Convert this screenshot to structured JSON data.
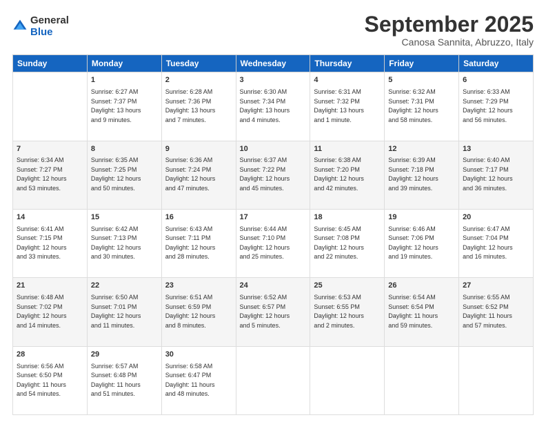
{
  "logo": {
    "general": "General",
    "blue": "Blue"
  },
  "title": "September 2025",
  "location": "Canosa Sannita, Abruzzo, Italy",
  "days_header": [
    "Sunday",
    "Monday",
    "Tuesday",
    "Wednesday",
    "Thursday",
    "Friday",
    "Saturday"
  ],
  "weeks": [
    [
      {
        "day": "",
        "content": ""
      },
      {
        "day": "1",
        "content": "Sunrise: 6:27 AM\nSunset: 7:37 PM\nDaylight: 13 hours\nand 9 minutes."
      },
      {
        "day": "2",
        "content": "Sunrise: 6:28 AM\nSunset: 7:36 PM\nDaylight: 13 hours\nand 7 minutes."
      },
      {
        "day": "3",
        "content": "Sunrise: 6:30 AM\nSunset: 7:34 PM\nDaylight: 13 hours\nand 4 minutes."
      },
      {
        "day": "4",
        "content": "Sunrise: 6:31 AM\nSunset: 7:32 PM\nDaylight: 13 hours\nand 1 minute."
      },
      {
        "day": "5",
        "content": "Sunrise: 6:32 AM\nSunset: 7:31 PM\nDaylight: 12 hours\nand 58 minutes."
      },
      {
        "day": "6",
        "content": "Sunrise: 6:33 AM\nSunset: 7:29 PM\nDaylight: 12 hours\nand 56 minutes."
      }
    ],
    [
      {
        "day": "7",
        "content": "Sunrise: 6:34 AM\nSunset: 7:27 PM\nDaylight: 12 hours\nand 53 minutes."
      },
      {
        "day": "8",
        "content": "Sunrise: 6:35 AM\nSunset: 7:25 PM\nDaylight: 12 hours\nand 50 minutes."
      },
      {
        "day": "9",
        "content": "Sunrise: 6:36 AM\nSunset: 7:24 PM\nDaylight: 12 hours\nand 47 minutes."
      },
      {
        "day": "10",
        "content": "Sunrise: 6:37 AM\nSunset: 7:22 PM\nDaylight: 12 hours\nand 45 minutes."
      },
      {
        "day": "11",
        "content": "Sunrise: 6:38 AM\nSunset: 7:20 PM\nDaylight: 12 hours\nand 42 minutes."
      },
      {
        "day": "12",
        "content": "Sunrise: 6:39 AM\nSunset: 7:18 PM\nDaylight: 12 hours\nand 39 minutes."
      },
      {
        "day": "13",
        "content": "Sunrise: 6:40 AM\nSunset: 7:17 PM\nDaylight: 12 hours\nand 36 minutes."
      }
    ],
    [
      {
        "day": "14",
        "content": "Sunrise: 6:41 AM\nSunset: 7:15 PM\nDaylight: 12 hours\nand 33 minutes."
      },
      {
        "day": "15",
        "content": "Sunrise: 6:42 AM\nSunset: 7:13 PM\nDaylight: 12 hours\nand 30 minutes."
      },
      {
        "day": "16",
        "content": "Sunrise: 6:43 AM\nSunset: 7:11 PM\nDaylight: 12 hours\nand 28 minutes."
      },
      {
        "day": "17",
        "content": "Sunrise: 6:44 AM\nSunset: 7:10 PM\nDaylight: 12 hours\nand 25 minutes."
      },
      {
        "day": "18",
        "content": "Sunrise: 6:45 AM\nSunset: 7:08 PM\nDaylight: 12 hours\nand 22 minutes."
      },
      {
        "day": "19",
        "content": "Sunrise: 6:46 AM\nSunset: 7:06 PM\nDaylight: 12 hours\nand 19 minutes."
      },
      {
        "day": "20",
        "content": "Sunrise: 6:47 AM\nSunset: 7:04 PM\nDaylight: 12 hours\nand 16 minutes."
      }
    ],
    [
      {
        "day": "21",
        "content": "Sunrise: 6:48 AM\nSunset: 7:02 PM\nDaylight: 12 hours\nand 14 minutes."
      },
      {
        "day": "22",
        "content": "Sunrise: 6:50 AM\nSunset: 7:01 PM\nDaylight: 12 hours\nand 11 minutes."
      },
      {
        "day": "23",
        "content": "Sunrise: 6:51 AM\nSunset: 6:59 PM\nDaylight: 12 hours\nand 8 minutes."
      },
      {
        "day": "24",
        "content": "Sunrise: 6:52 AM\nSunset: 6:57 PM\nDaylight: 12 hours\nand 5 minutes."
      },
      {
        "day": "25",
        "content": "Sunrise: 6:53 AM\nSunset: 6:55 PM\nDaylight: 12 hours\nand 2 minutes."
      },
      {
        "day": "26",
        "content": "Sunrise: 6:54 AM\nSunset: 6:54 PM\nDaylight: 11 hours\nand 59 minutes."
      },
      {
        "day": "27",
        "content": "Sunrise: 6:55 AM\nSunset: 6:52 PM\nDaylight: 11 hours\nand 57 minutes."
      }
    ],
    [
      {
        "day": "28",
        "content": "Sunrise: 6:56 AM\nSunset: 6:50 PM\nDaylight: 11 hours\nand 54 minutes."
      },
      {
        "day": "29",
        "content": "Sunrise: 6:57 AM\nSunset: 6:48 PM\nDaylight: 11 hours\nand 51 minutes."
      },
      {
        "day": "30",
        "content": "Sunrise: 6:58 AM\nSunset: 6:47 PM\nDaylight: 11 hours\nand 48 minutes."
      },
      {
        "day": "",
        "content": ""
      },
      {
        "day": "",
        "content": ""
      },
      {
        "day": "",
        "content": ""
      },
      {
        "day": "",
        "content": ""
      }
    ]
  ]
}
